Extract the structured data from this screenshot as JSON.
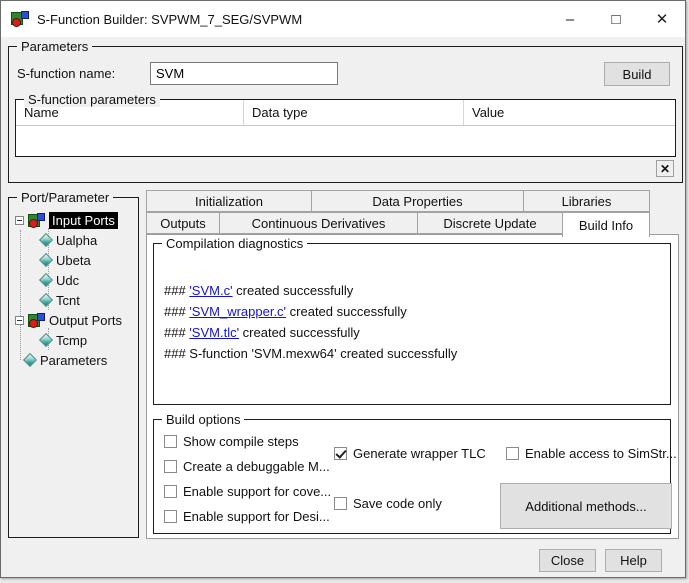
{
  "window": {
    "title": "S-Function Builder: SVPWM_7_SEG/SVPWM",
    "minimize_glyph": "–",
    "maximize_glyph": "□",
    "close_glyph": "✕"
  },
  "parameters": {
    "group_label": "Parameters",
    "name_label": "S-function name:",
    "name_value": "SVM",
    "build_button": "Build",
    "sfp_group_label": "S-function parameters",
    "table_headers": [
      "Name",
      "Data type",
      "Value"
    ],
    "clear_button_glyph": "✕"
  },
  "port_parameter": {
    "group_label": "Port/Parameter",
    "input_ports_label": "Input Ports",
    "input_ports": [
      "Ualpha",
      "Ubeta",
      "Udc",
      "Tcnt"
    ],
    "output_ports_label": "Output Ports",
    "output_ports": [
      "Tcmp"
    ],
    "parameters_label": "Parameters"
  },
  "tabs": {
    "row1": [
      "Initialization",
      "Data Properties",
      "Libraries"
    ],
    "row2": [
      "Outputs",
      "Continuous Derivatives",
      "Discrete Update",
      "Build Info"
    ],
    "active": "Build Info"
  },
  "build_info": {
    "diagnostics": {
      "group_label": "Compilation diagnostics",
      "lines": [
        {
          "prefix": "### ",
          "link": "'SVM.c'",
          "suffix": " created successfully"
        },
        {
          "prefix": "### ",
          "link": "'SVM_wrapper.c'",
          "suffix": " created successfully"
        },
        {
          "prefix": "### ",
          "link": "'SVM.tlc'",
          "suffix": " created successfully"
        },
        {
          "prefix": "### S-function 'SVM.mexw64' created successfully",
          "link": "",
          "suffix": ""
        }
      ]
    },
    "build_options": {
      "group_label": "Build options",
      "col1": [
        {
          "label": "Show compile steps",
          "checked": false
        },
        {
          "label": "Create a debuggable M...",
          "checked": false
        },
        {
          "label": "Enable support for cove...",
          "checked": false
        },
        {
          "label": "Enable support for Desi...",
          "checked": false
        }
      ],
      "col2": [
        {
          "label": "Generate wrapper TLC",
          "checked": true
        },
        {
          "label": "Save code only",
          "checked": false
        }
      ],
      "col3": [
        {
          "label": "Enable access to SimStr...",
          "checked": false
        }
      ],
      "additional_methods_button": "Additional methods..."
    }
  },
  "footer": {
    "close_button": "Close",
    "help_button": "Help"
  }
}
